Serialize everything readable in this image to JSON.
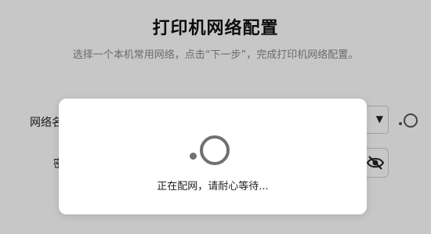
{
  "page": {
    "title": "打印机网络配置",
    "subtitle": "选择一个本机常用网络，点击“下一步”，完成打印机网络配置。"
  },
  "form": {
    "ssid_label": "网络名",
    "ssid_dropdown_arrow": "▼",
    "password_label": "密码"
  },
  "icons": {
    "refresh": "refresh-icon",
    "eye": "eye-slash-icon",
    "spinner": "loading-spinner-icon"
  },
  "dialog": {
    "message": "正在配网，请耐心等待..."
  },
  "colors": {
    "overlay": "#c8c8c8",
    "spinner": "#707070"
  }
}
